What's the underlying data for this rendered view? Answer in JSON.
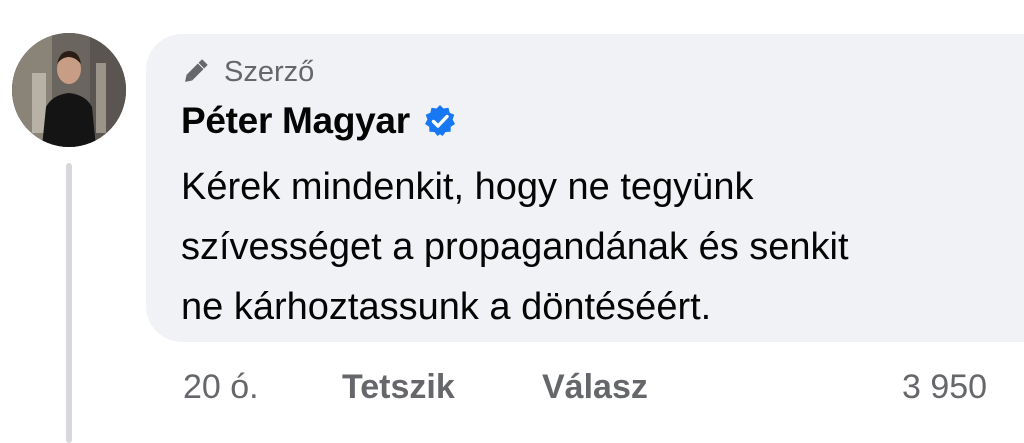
{
  "comment": {
    "badge": {
      "label": "Szerző",
      "icon": "pen-icon"
    },
    "author": {
      "name": "Péter Magyar",
      "verified_icon": "verified-badge-icon"
    },
    "text_lines": [
      "Kérek mindenkit, hogy ne tegyünk",
      "szívességet a propagandának és senkit",
      "ne kárhoztassunk a döntéséért."
    ],
    "actions": {
      "time": "20 ó.",
      "like_label": "Tetszik",
      "reply_label": "Válasz",
      "reaction_count": "3 950"
    }
  },
  "colors": {
    "bubble": "#f0f2f5",
    "secondary_text": "#65676b",
    "primary_text": "#050505",
    "verified_blue": "#1877f2"
  }
}
